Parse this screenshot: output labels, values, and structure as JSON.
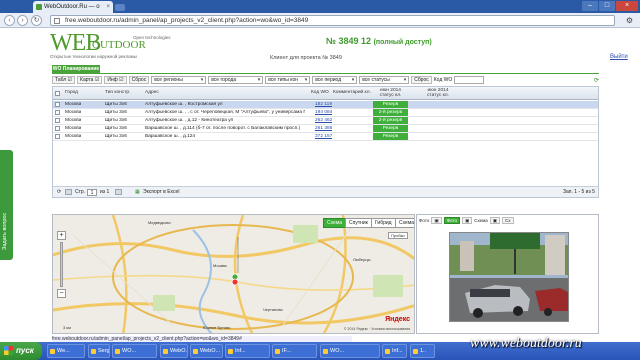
{
  "browser": {
    "tab_title": "WebOutdoor.Ru — o",
    "url": "free.weboutdoor.ru/admin_panel/ap_projects_v2_client.php?action=wo&wo_id=3849"
  },
  "logo": {
    "web": "WEB",
    "outdoor": "OUTDOOR",
    "open_tech": "Open technologies",
    "tagline": "Открытые технологии наружной рекламы"
  },
  "header": {
    "title": "№ 3849 12",
    "title_suffix": "(полный доступ)",
    "client_text": "Клиент для проекта № 3849",
    "logout": "Выйти"
  },
  "green_tab": "WO Планирование",
  "side_tab": "Задать вопрос",
  "filters": {
    "table_btn": "Табл",
    "map_btn": "Карта",
    "info_btn": "Инф",
    "reset": "Сброс",
    "regions": "все регионы",
    "cities": "все города",
    "types": "все типы кон",
    "periods": "все период",
    "statuses": "все статусы",
    "reset2": "Сброс",
    "code_label": "Код WO"
  },
  "table": {
    "headers": {
      "city": "Город",
      "type": "Тип констр.",
      "address": "Адрес",
      "code": "Код WO",
      "comment": "Комментарий кл.",
      "status1": "июн 2014 статус кл.",
      "status2": "июн 2014 статус кл."
    },
    "rows": [
      {
        "city": "Москва",
        "type": "Щиты 3х6",
        "address": "Алтуфьевское ш. , Костромская ул",
        "code": "182 119",
        "status": "Резерв",
        "status_kind": "green"
      },
      {
        "city": "Москва",
        "type": "Щиты 3х6",
        "address": "Алтуфьевское ш. , , с от. Череповецкая, М \"Алтуфьево\", у универсама П...",
        "code": "194 084",
        "status": "2-й резерв",
        "status_kind": "green"
      },
      {
        "city": "Москва",
        "type": "Щиты 3х6",
        "address": "Алтуфьевское ш. , д.12 - Кинотеатра ул",
        "code": "262 462",
        "status": "2-й резерв",
        "status_kind": "green"
      },
      {
        "city": "Москва",
        "type": "Щиты 3х6",
        "address": "Варшавское ш. , д.114 (б-7 от. после поворот. с Балаклавским просп.)",
        "code": "261 385",
        "status": "Резерв",
        "status_kind": "green"
      },
      {
        "city": "Москва",
        "type": "Щиты 3х6",
        "address": "Варшавское ш. , д.124",
        "code": "372 157",
        "status": "Резерв",
        "status_kind": "green"
      }
    ],
    "footer": {
      "page_label": "Стр.",
      "page_value": "1",
      "of_label": "из 1",
      "export": "Экспорт в Excel",
      "records": "Зап. 1 - 5 из 5"
    }
  },
  "map": {
    "tabs": [
      "Схема",
      "Спутник",
      "Гибрид",
      "Схема"
    ],
    "traffic": "Пробки",
    "logo": "Яндекс",
    "copyright": "© 2014 Яндекс · Условия использования",
    "scale": "3 км",
    "labels": [
      "Медведково",
      "Чертаново",
      "Москва",
      "Южное Бутово",
      "Люберцы"
    ]
  },
  "photo_panel": {
    "tabs": [
      "Фото",
      "Фото",
      "Схема",
      "Сх"
    ],
    "active_tab_index": 1
  },
  "statusbar": "free.weboutdoor.ru/admin_panel/ap_projects_v2_client.php?action=wo&wo_id=3849#",
  "taskbar": {
    "start": "пуск",
    "items": [
      "We...",
      "Serge...",
      "WO...",
      "WebO...",
      "WebO...",
      "Inf...",
      "IF...",
      "WO...",
      "Inf...",
      "1.."
    ]
  },
  "watermark": "www.weboutdoor.ru",
  "colors": {
    "brand_green": "#4e9a2c",
    "status_green": "#3fae3a",
    "link_blue": "#2b4fb0"
  }
}
